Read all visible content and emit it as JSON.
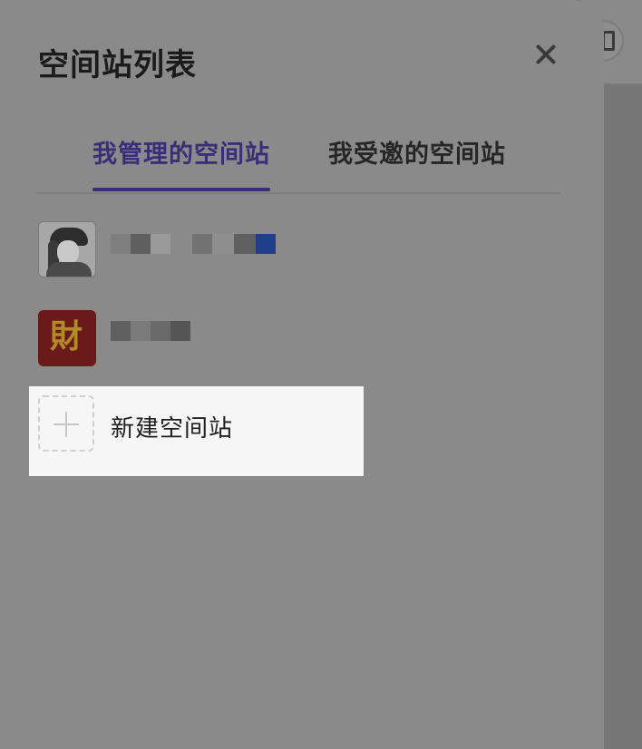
{
  "drawer": {
    "title": "空间站列表",
    "close_icon": "close-icon"
  },
  "tabs": [
    {
      "label": "我管理的空间站",
      "active": true
    },
    {
      "label": "我受邀的空间站",
      "active": false
    }
  ],
  "stations": [
    {
      "name": "",
      "avatar": "user-photo-avatar",
      "name_obscured": true
    },
    {
      "name": "",
      "avatar_text": "財",
      "name_obscured": true
    }
  ],
  "new_station": {
    "label": "新建空间站",
    "icon": "plus-icon"
  },
  "colors": {
    "accent": "#3b2e78",
    "overlay": "#8a8a8a",
    "highlight": "#f6f6f6"
  }
}
